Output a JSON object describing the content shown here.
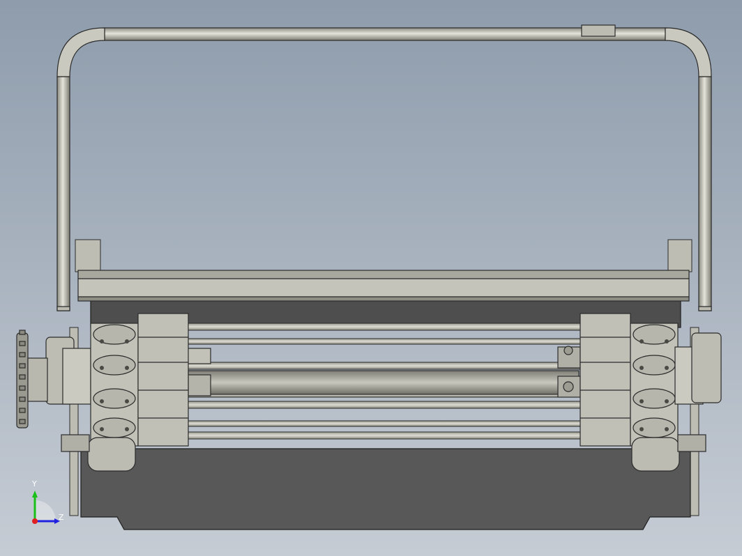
{
  "viewport": {
    "background_top": "#8e9cac",
    "background_bottom": "#c4cbd3"
  },
  "triad": {
    "y_label": "Y",
    "z_label": "Z",
    "y_color": "#18c018",
    "z_color": "#2020e0",
    "origin_color": "#e02020"
  },
  "model": {
    "body_color": "#b8b8ac",
    "edge_color": "#2a2a2a",
    "dark_panel_color": "#585858",
    "sprocket_color": "#9a9a90"
  }
}
